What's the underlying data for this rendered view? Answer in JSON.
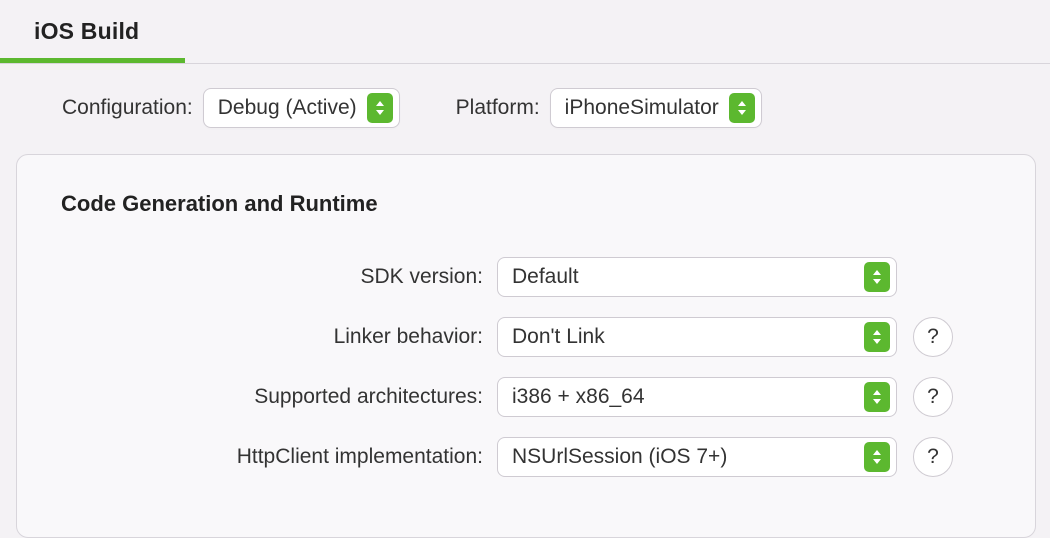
{
  "tab": {
    "title": "iOS Build"
  },
  "top": {
    "configuration_label": "Configuration:",
    "configuration_value": "Debug (Active)",
    "platform_label": "Platform:",
    "platform_value": "iPhoneSimulator"
  },
  "section": {
    "title": "Code Generation and Runtime",
    "rows": {
      "sdk": {
        "label": "SDK version:",
        "value": "Default",
        "has_help": false
      },
      "linker": {
        "label": "Linker behavior:",
        "value": "Don't Link",
        "has_help": true
      },
      "arch": {
        "label": "Supported architectures:",
        "value": "i386 + x86_64",
        "has_help": true
      },
      "http": {
        "label": "HttpClient implementation:",
        "value": "NSUrlSession (iOS 7+)",
        "has_help": true
      }
    }
  },
  "icons": {
    "help": "?"
  }
}
